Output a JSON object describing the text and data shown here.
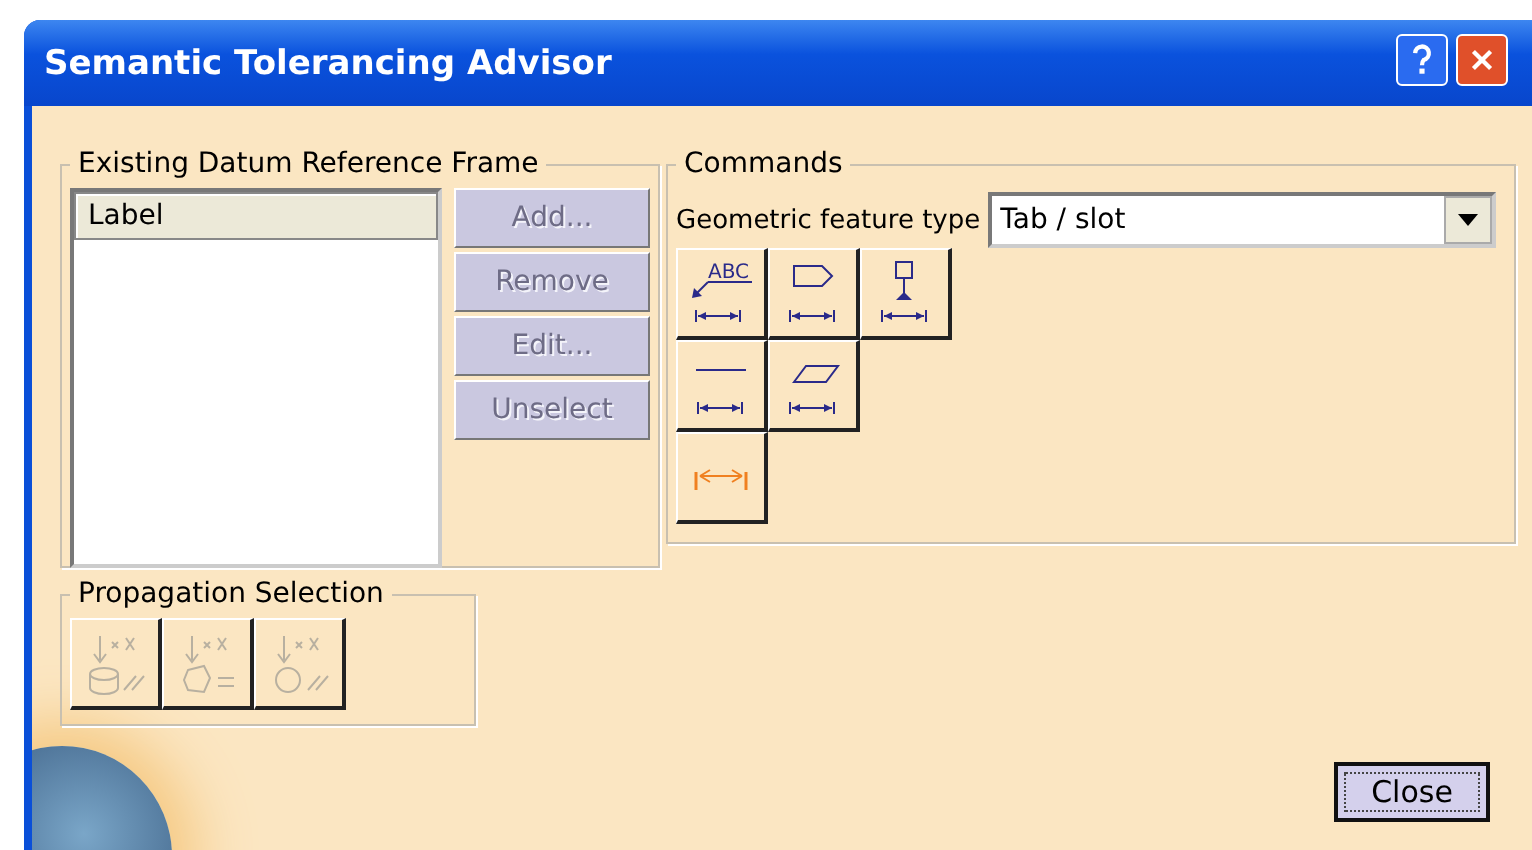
{
  "window": {
    "title": "Semantic Tolerancing Advisor"
  },
  "datum_frame": {
    "title": "Existing Datum Reference Frame",
    "list_header": "Label",
    "buttons": [
      {
        "label": "Add...",
        "disabled": true
      },
      {
        "label": "Remove",
        "disabled": true
      },
      {
        "label": "Edit...",
        "disabled": true
      },
      {
        "label": "Unselect",
        "disabled": true
      }
    ]
  },
  "commands": {
    "title": "Commands",
    "feature_label": "Geometric feature type",
    "feature_value": "Tab / slot",
    "tools": [
      [
        {
          "kind": "text-note",
          "text": "ABC"
        },
        {
          "kind": "flag"
        },
        {
          "kind": "datum-target"
        }
      ],
      [
        {
          "kind": "line"
        },
        {
          "kind": "plane"
        }
      ],
      [
        {
          "kind": "dimension"
        }
      ]
    ]
  },
  "propagation": {
    "title": "Propagation Selection",
    "tools": [
      {
        "kind": "cylinder",
        "disabled": true
      },
      {
        "kind": "polygon",
        "disabled": true
      },
      {
        "kind": "circle",
        "disabled": true
      }
    ]
  },
  "close_button": "Close"
}
